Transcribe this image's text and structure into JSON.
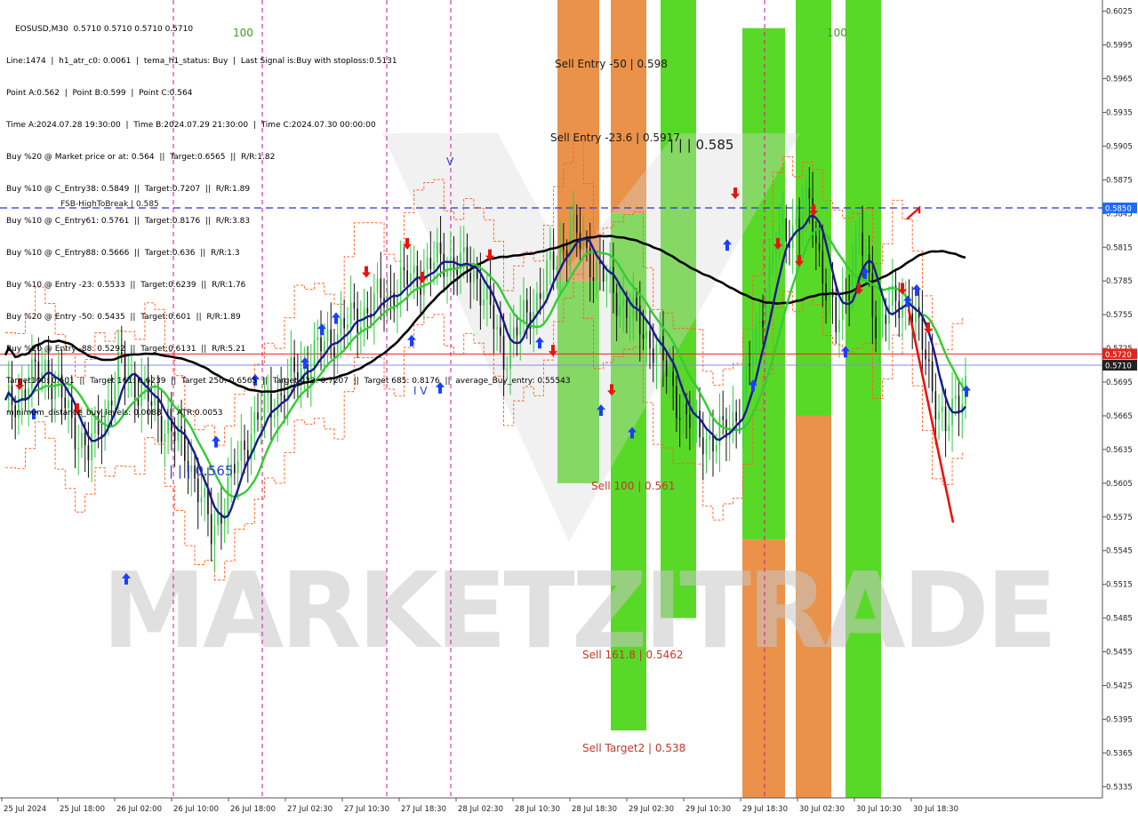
{
  "header": {
    "symbol_line": "EOSUSD,M30  0.5710 0.5710 0.5710 0.5710",
    "info_lines": [
      "Line:1474  |  h1_atr_c0: 0.0061  |  tema_h1_status: Buy  |  Last Signal is:Buy with stoploss:0.5131",
      "Point A:0.562  |  Point B:0.599  |  Point C:0.564",
      "Time A:2024.07.28 19:30:00  |  Time B:2024.07.29 21:30:00  |  Time C:2024.07.30 00:00:00",
      "Buy %20 @ Market price or at: 0.564  ||  Target:0.6565  ||  R/R:1.82",
      "Buy %10 @ C_Entry38: 0.5849  ||  Target:0.7207  ||  R/R:1.89",
      "Buy %10 @ C_Entry61: 0.5761  ||  Target:0.8176  ||  R/R:3.83",
      "Buy %10 @ C_Entry88: 0.5666  ||  Target:0.636  ||  R/R:1.3",
      "Buy %10 @ Entry -23: 0.5533  ||  Target:0.6239  ||  R/R:1.76",
      "Buy %20 @ Entry -50: 0.5435  ||  Target:0.601  ||  R/R:1.89",
      "Buy %20 @ Entry -88: 0.5292  ||  Target:0.6131  ||  R/R:5.21",
      "Target100: 0.601  ||  Target 161: 0.6239  ||  Target 250: 0.6565  ||  Target 423: 0.7207  ||  Target 685: 0.8176  ||  average_Buy_entry: 0.55543",
      "minimum_distance_buy_levels: 0.0088  ||  ATR:0.0053"
    ]
  },
  "chart_data": {
    "type": "candlestick",
    "symbol": "EOSUSD",
    "timeframe": "M30",
    "ylim": [
      0.5325,
      0.6035
    ],
    "y_ticks": [
      "0.6025",
      "0.5995",
      "0.5965",
      "0.5935",
      "0.5905",
      "0.5875",
      "0.5845",
      "0.5815",
      "0.5785",
      "0.5755",
      "0.5725",
      "0.5695",
      "0.5665",
      "0.5635",
      "0.5605",
      "0.5575",
      "0.5545",
      "0.5515",
      "0.5485",
      "0.5455",
      "0.5425",
      "0.5395",
      "0.5365",
      "0.5335"
    ],
    "x_ticks": [
      "25 Jul 2024",
      "25 Jul 18:00",
      "26 Jul 02:00",
      "26 Jul 10:00",
      "26 Jul 18:00",
      "27 Jul 02:30",
      "27 Jul 10:30",
      "27 Jul 18:30",
      "28 Jul 02:30",
      "28 Jul 10:30",
      "28 Jul 18:30",
      "29 Jul 02:30",
      "29 Jul 10:30",
      "29 Jul 18:30",
      "30 Jul 02:30",
      "30 Jul 10:30",
      "30 Jul 18:30"
    ],
    "price_badges": [
      {
        "label": "0.5850",
        "value": 0.585,
        "color": "#1e6bff"
      },
      {
        "label": "0.5720",
        "value": 0.572,
        "color": "#e8241a"
      },
      {
        "label": "0.5710",
        "value": 0.571,
        "color": "#222222"
      }
    ],
    "level_labels": [
      {
        "text": "Sell Entry -50 | 0.598",
        "value": 0.598,
        "color": "#1a1a1a"
      },
      {
        "text": "Sell Entry -23.6 | 0.5917",
        "value": 0.5917,
        "color": "#1a1a1a"
      },
      {
        "text": "| | | 0.585",
        "value": 0.585,
        "color": "#1a1a1a"
      },
      {
        "text": "FSB-HighToBreak | 0.585",
        "value": 0.585,
        "color": "#1a1a1a"
      },
      {
        "text": "Sell 100 | 0.561",
        "value": 0.561,
        "color": "#c0392b"
      },
      {
        "text": "Sell 161.8 | 0.5462",
        "value": 0.5462,
        "color": "#c0392b"
      },
      {
        "text": "Sell Target2 | 0.538",
        "value": 0.538,
        "color": "#c0392b"
      },
      {
        "text": "| | | 0.565",
        "value": 0.565,
        "color": "#2a3fd0"
      }
    ],
    "small_labels": [
      "100",
      "100",
      "I V",
      "V"
    ],
    "watermark": "MARKETZITRADE",
    "colors": {
      "bull_candle": "#2ecc40",
      "bear_candle": "#111111",
      "ma_long": "#000000",
      "ma_mid": "#1a1a8c",
      "ma_fast": "#32cd32",
      "band": "#ff5a1f",
      "zone_green": "#4cd617",
      "zone_orange": "#e88a3c",
      "buy_arrow": "#1a3fff",
      "sell_arrow": "#e8140c"
    }
  }
}
